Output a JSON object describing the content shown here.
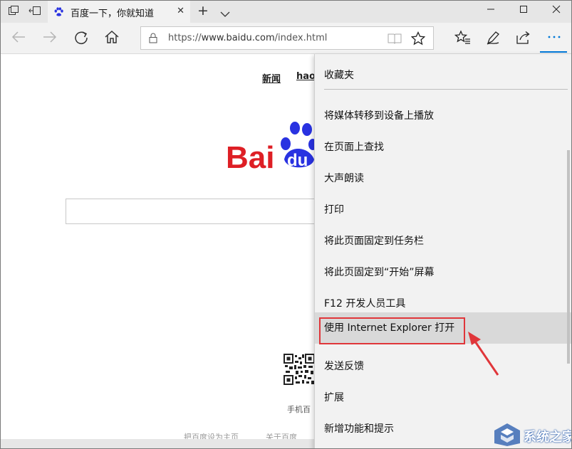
{
  "browser": {
    "tab_title": "百度一下，你就知道",
    "url_prefix": "https://",
    "url_host": "www.baidu.com",
    "url_path": "/index.html"
  },
  "page": {
    "top_links": [
      "新闻",
      "hao"
    ],
    "logo_text_left": "Bai",
    "logo_text_right": "du",
    "qr_caption": "手机百",
    "footer_links": [
      "把百度设为主页",
      "关于百度"
    ]
  },
  "menu": {
    "items": [
      "收藏夹",
      "将媒体转移到设备上播放",
      "在页面上查找",
      "大声朗读",
      "打印",
      "将此页面固定到任务栏",
      "将此页固定到“开始”屏幕",
      "F12 开发人员工具",
      "使用 Internet Explorer 打开",
      "发送反馈",
      "扩展",
      "新增功能和提示"
    ],
    "highlighted_index": 8
  },
  "watermark": {
    "text": "系统之家"
  },
  "colors": {
    "accent": "#0078d7",
    "highlight_box": "#e0363a",
    "baidu_red": "#de1f25",
    "baidu_blue": "#2932e1"
  },
  "icons": {
    "tab_actions": [
      "set-aside-tabs-icon",
      "restore-tabs-icon"
    ],
    "nav": [
      "back-icon",
      "forward-icon",
      "refresh-icon",
      "home-icon"
    ],
    "toolbar": [
      "favorites-hub-icon",
      "notes-icon",
      "share-icon",
      "more-icon"
    ]
  }
}
